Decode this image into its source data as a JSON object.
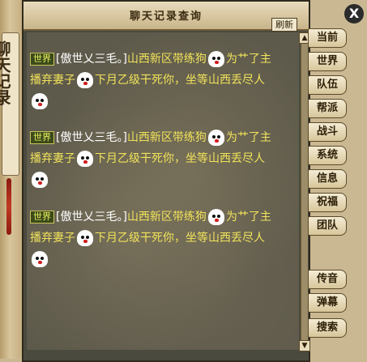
{
  "window": {
    "title": "聊天记录查询",
    "refresh_label": "刷新",
    "close_label": "X"
  },
  "left_scroll": {
    "text": "聊天记录"
  },
  "tabs": [
    {
      "label": "当前"
    },
    {
      "label": "世界"
    },
    {
      "label": "队伍"
    },
    {
      "label": "帮派"
    },
    {
      "label": "战斗"
    },
    {
      "label": "系统"
    },
    {
      "label": "信息"
    },
    {
      "label": "祝福"
    },
    {
      "label": "团队"
    },
    {
      "label": "传音"
    },
    {
      "label": "弹幕"
    },
    {
      "label": "搜索"
    }
  ],
  "messages": [
    {
      "channel": "世界",
      "user": "[傲世乂三毛。]",
      "part1": "山西新区带练狗",
      "part2": "为艹了主",
      "part3": "播弃妻子",
      "part4": "下月乙级干死你，坐等山西丢尽人"
    },
    {
      "channel": "世界",
      "user": "[傲世乂三毛。]",
      "part1": "山西新区带练狗",
      "part2": "为艹了主",
      "part3": "播弃妻子",
      "part4": "下月乙级干死你，坐等山西丢尽人"
    },
    {
      "channel": "世界",
      "user": "[傲世乂三毛。]",
      "part1": "山西新区带练狗",
      "part2": "为艹了主",
      "part3": "播弃妻子",
      "part4": "下月乙级干死你，坐等山西丢尽人"
    }
  ],
  "scrollbar": {
    "up_icon": "▲",
    "down_icon": "▼"
  },
  "colors": {
    "message_text": "#f1e35a",
    "channel_badge_bg": "#3b4a1a",
    "panel_bg": "#5e5a4b"
  }
}
